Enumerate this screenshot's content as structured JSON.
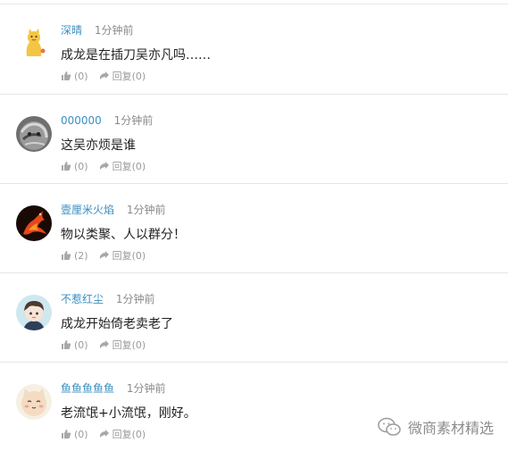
{
  "comments": [
    {
      "username": "深晴",
      "time": "1分钟前",
      "text": "成龙是在插刀吴亦凡吗……",
      "likes": "(0)",
      "reply_label": "回复",
      "reply_count": "(0)",
      "avatar": "cat-cartoon-avatar"
    },
    {
      "username": "000000",
      "time": "1分钟前",
      "text": "这吴亦烦是谁",
      "likes": "(0)",
      "reply_label": "回复",
      "reply_count": "(0)",
      "avatar": "gray-animal-avatar"
    },
    {
      "username": "壹厘米火焰",
      "time": "1分钟前",
      "text": "物以类聚、人以群分！",
      "likes": "(2)",
      "reply_label": "回复",
      "reply_count": "(0)",
      "avatar": "fire-horse-avatar"
    },
    {
      "username": "不惹红尘",
      "time": "1分钟前",
      "text": "成龙开始倚老卖老了",
      "likes": "(0)",
      "reply_label": "回复",
      "reply_count": "(0)",
      "avatar": "anime-boy-avatar"
    },
    {
      "username": "鱼鱼鱼鱼鱼",
      "time": "1分钟前",
      "text": "老流氓+小流氓，刚好。",
      "likes": "(0)",
      "reply_label": "回复",
      "reply_count": "(0)",
      "avatar": "cute-cat-avatar"
    }
  ],
  "watermark": {
    "text": "微商素材精选",
    "icon": "wechat-icon"
  },
  "colors": {
    "username": "#3a8fc0",
    "time": "#8a8a8a",
    "action": "#9a9a9a",
    "divider": "#e5e5e5"
  }
}
